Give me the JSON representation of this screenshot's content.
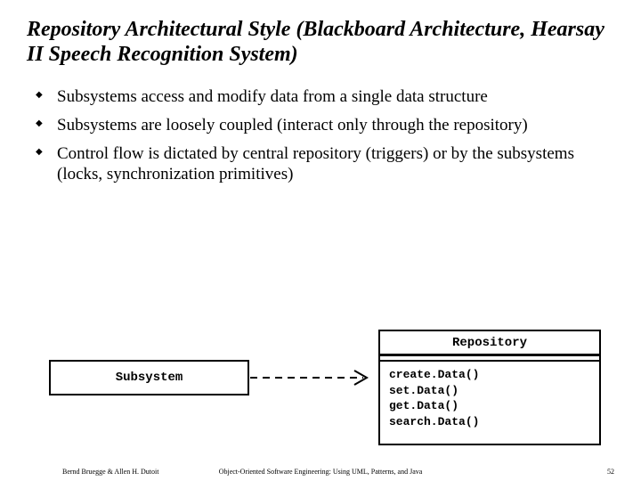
{
  "title": "Repository Architectural Style (Blackboard Architecture, Hearsay II Speech Recognition System)",
  "bullets": [
    "Subsystems access and modify data from a single data structure",
    "Subsystems are loosely coupled (interact only through the repository)",
    "Control flow is dictated by central repository (triggers) or by the subsystems (locks, synchronization primitives)"
  ],
  "diagram": {
    "subsystem_label": "Subsystem",
    "repository_label": "Repository",
    "methods": [
      "create.Data()",
      "set.Data()",
      "get.Data()",
      "search.Data()"
    ]
  },
  "footer": {
    "left": "Bernd Bruegge & Allen H. Dutoit",
    "center": "Object-Oriented Software Engineering: Using UML, Patterns, and Java",
    "right": "52"
  }
}
